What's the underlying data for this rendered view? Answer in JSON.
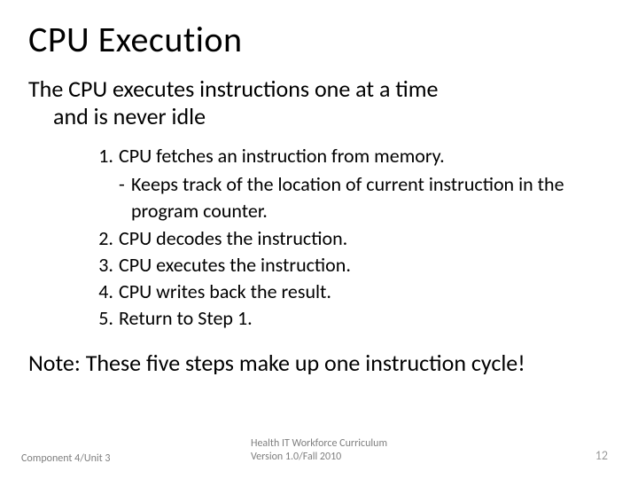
{
  "title": "CPU Execution",
  "lead_line1": "The CPU executes instructions one at a time",
  "lead_line2": "and is never idle",
  "steps": [
    {
      "num": "1.",
      "text": "CPU fetches an instruction from memory."
    },
    {
      "num": "2.",
      "text": "CPU decodes the instruction."
    },
    {
      "num": "3.",
      "text": "CPU executes the instruction."
    },
    {
      "num": "4.",
      "text": "CPU writes back the result."
    },
    {
      "num": "5.",
      "text": "Return to Step 1."
    }
  ],
  "substep_dash": "-",
  "substep_text": "Keeps track of the location of current instruction in the program counter.",
  "note": "Note: These five steps make up one instruction cycle!",
  "footer": {
    "left": "Component 4/Unit 3",
    "center_line1": "Health IT Workforce Curriculum",
    "center_line2": "Version 1.0/Fall 2010",
    "right": "12"
  }
}
